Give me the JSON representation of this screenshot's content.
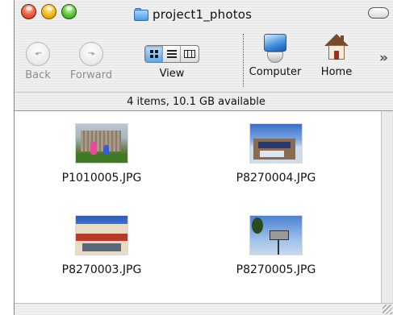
{
  "window": {
    "title": "project1_photos",
    "folder_icon": "folder-icon"
  },
  "toolbar": {
    "back_label": "Back",
    "forward_label": "Forward",
    "view_label": "View",
    "computer_label": "Computer",
    "home_label": "Home",
    "view_modes": [
      "icon-view",
      "list-view",
      "column-view"
    ],
    "active_view": "icon-view",
    "overflow_glyph": "»"
  },
  "status": {
    "text": "4 items, 10.1 GB available"
  },
  "items": [
    {
      "name": "P1010005.JPG"
    },
    {
      "name": "P8270004.JPG"
    },
    {
      "name": "P8270003.JPG"
    },
    {
      "name": "P8270005.JPG"
    }
  ]
}
